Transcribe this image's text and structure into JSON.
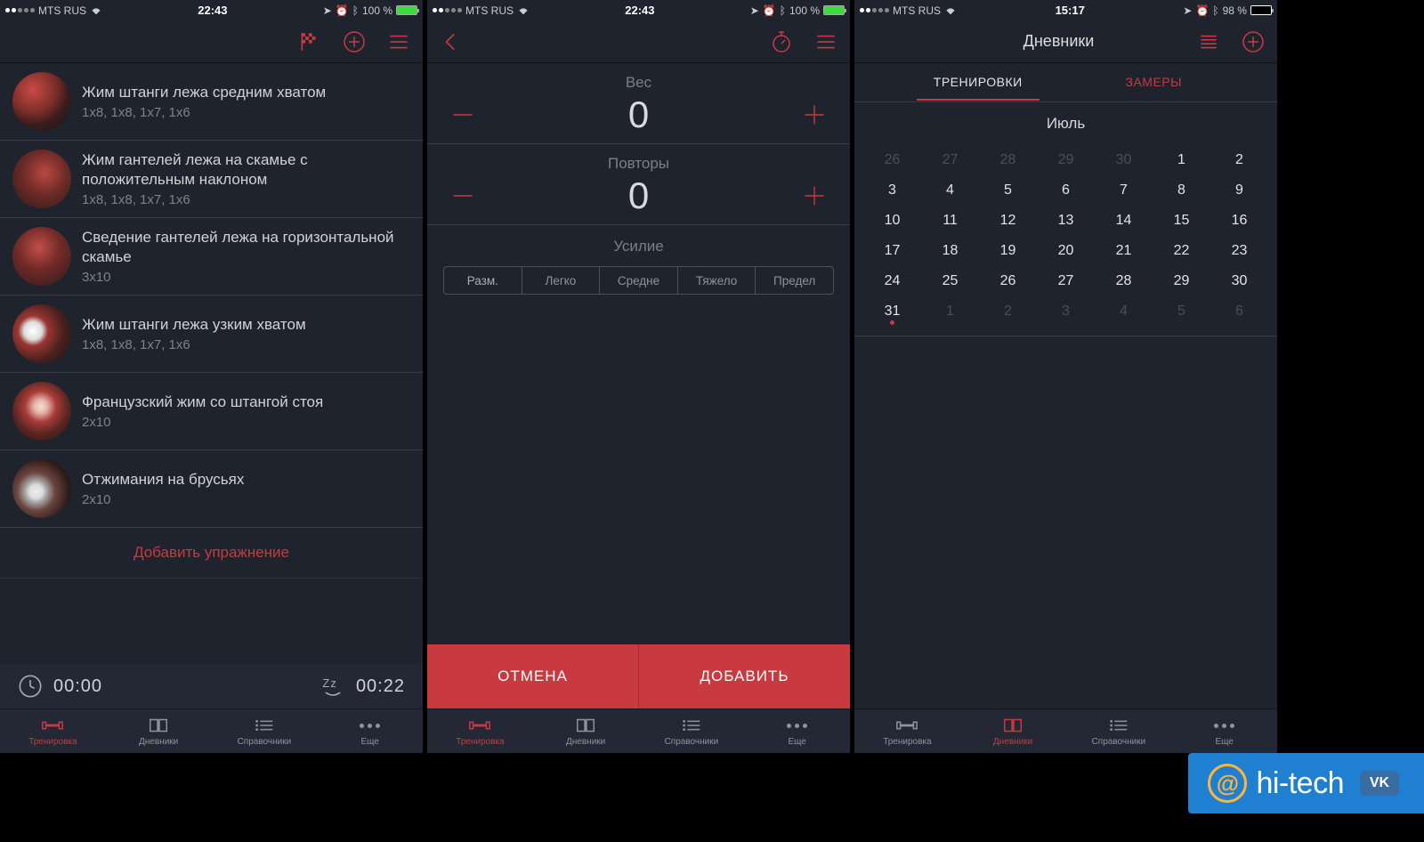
{
  "status": {
    "carrier": "MTS RUS",
    "time1": "22:43",
    "time2": "22:43",
    "time3": "15:17",
    "battery1": "100 %",
    "battery3": "98 %"
  },
  "screen1": {
    "exercises": [
      {
        "name": "Жим штанги лежа средним хватом",
        "sets": "1x8, 1x8, 1x7, 1x6"
      },
      {
        "name": "Жим гантелей лежа на скамье с положительным наклоном",
        "sets": "1x8, 1x8, 1x7, 1x6"
      },
      {
        "name": "Сведение гантелей лежа на горизонтальной скамье",
        "sets": "3x10"
      },
      {
        "name": "Жим штанги лежа узким хватом",
        "sets": "1x8, 1x8, 1x7, 1x6"
      },
      {
        "name": "Французский жим со штангой стоя",
        "sets": "2x10"
      },
      {
        "name": "Отжимания на брусьях",
        "sets": "2x10"
      }
    ],
    "add_exercise": "Добавить упражнение",
    "timer_elapsed": "00:00",
    "timer_rest": "00:22"
  },
  "screen2": {
    "weight_label": "Вес",
    "weight_value": "0",
    "reps_label": "Повторы",
    "reps_value": "0",
    "effort_label": "Усилие",
    "effort_options": [
      "Разм.",
      "Легко",
      "Средне",
      "Тяжело",
      "Предел"
    ],
    "cancel": "ОТМЕНА",
    "add": "ДОБАВИТЬ"
  },
  "screen3": {
    "title": "Дневники",
    "tab_trainings": "ТРЕНИРОВКИ",
    "tab_measures": "ЗАМЕРЫ",
    "month": "Июль",
    "weeks": [
      [
        {
          "d": "26",
          "dim": true
        },
        {
          "d": "27",
          "dim": true
        },
        {
          "d": "28",
          "dim": true
        },
        {
          "d": "29",
          "dim": true
        },
        {
          "d": "30",
          "dim": true
        },
        {
          "d": "1"
        },
        {
          "d": "2"
        }
      ],
      [
        {
          "d": "3"
        },
        {
          "d": "4"
        },
        {
          "d": "5"
        },
        {
          "d": "6"
        },
        {
          "d": "7"
        },
        {
          "d": "8"
        },
        {
          "d": "9"
        }
      ],
      [
        {
          "d": "10"
        },
        {
          "d": "11"
        },
        {
          "d": "12"
        },
        {
          "d": "13"
        },
        {
          "d": "14"
        },
        {
          "d": "15"
        },
        {
          "d": "16"
        }
      ],
      [
        {
          "d": "17"
        },
        {
          "d": "18"
        },
        {
          "d": "19"
        },
        {
          "d": "20"
        },
        {
          "d": "21"
        },
        {
          "d": "22"
        },
        {
          "d": "23"
        }
      ],
      [
        {
          "d": "24"
        },
        {
          "d": "25"
        },
        {
          "d": "26"
        },
        {
          "d": "27"
        },
        {
          "d": "28"
        },
        {
          "d": "29"
        },
        {
          "d": "30"
        }
      ],
      [
        {
          "d": "31",
          "marked": true
        },
        {
          "d": "1",
          "dim": true
        },
        {
          "d": "2",
          "dim": true
        },
        {
          "d": "3",
          "dim": true
        },
        {
          "d": "4",
          "dim": true
        },
        {
          "d": "5",
          "dim": true
        },
        {
          "d": "6",
          "dim": true
        }
      ]
    ]
  },
  "tabs": {
    "training": "Тренировка",
    "diaries": "Дневники",
    "reference": "Справочники",
    "more": "Еще"
  },
  "watermark": {
    "at": "@",
    "text": "hi-tech",
    "vk": "VK"
  }
}
